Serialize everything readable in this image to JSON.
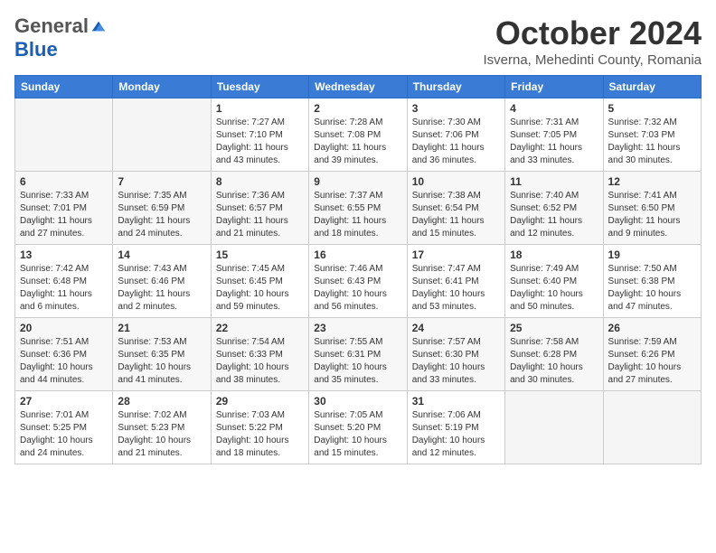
{
  "header": {
    "logo_general": "General",
    "logo_blue": "Blue",
    "month": "October 2024",
    "location": "Isverna, Mehedinti County, Romania"
  },
  "weekdays": [
    "Sunday",
    "Monday",
    "Tuesday",
    "Wednesday",
    "Thursday",
    "Friday",
    "Saturday"
  ],
  "weeks": [
    [
      {
        "day": "",
        "info": ""
      },
      {
        "day": "",
        "info": ""
      },
      {
        "day": "1",
        "info": "Sunrise: 7:27 AM\nSunset: 7:10 PM\nDaylight: 11 hours and 43 minutes."
      },
      {
        "day": "2",
        "info": "Sunrise: 7:28 AM\nSunset: 7:08 PM\nDaylight: 11 hours and 39 minutes."
      },
      {
        "day": "3",
        "info": "Sunrise: 7:30 AM\nSunset: 7:06 PM\nDaylight: 11 hours and 36 minutes."
      },
      {
        "day": "4",
        "info": "Sunrise: 7:31 AM\nSunset: 7:05 PM\nDaylight: 11 hours and 33 minutes."
      },
      {
        "day": "5",
        "info": "Sunrise: 7:32 AM\nSunset: 7:03 PM\nDaylight: 11 hours and 30 minutes."
      }
    ],
    [
      {
        "day": "6",
        "info": "Sunrise: 7:33 AM\nSunset: 7:01 PM\nDaylight: 11 hours and 27 minutes."
      },
      {
        "day": "7",
        "info": "Sunrise: 7:35 AM\nSunset: 6:59 PM\nDaylight: 11 hours and 24 minutes."
      },
      {
        "day": "8",
        "info": "Sunrise: 7:36 AM\nSunset: 6:57 PM\nDaylight: 11 hours and 21 minutes."
      },
      {
        "day": "9",
        "info": "Sunrise: 7:37 AM\nSunset: 6:55 PM\nDaylight: 11 hours and 18 minutes."
      },
      {
        "day": "10",
        "info": "Sunrise: 7:38 AM\nSunset: 6:54 PM\nDaylight: 11 hours and 15 minutes."
      },
      {
        "day": "11",
        "info": "Sunrise: 7:40 AM\nSunset: 6:52 PM\nDaylight: 11 hours and 12 minutes."
      },
      {
        "day": "12",
        "info": "Sunrise: 7:41 AM\nSunset: 6:50 PM\nDaylight: 11 hours and 9 minutes."
      }
    ],
    [
      {
        "day": "13",
        "info": "Sunrise: 7:42 AM\nSunset: 6:48 PM\nDaylight: 11 hours and 6 minutes."
      },
      {
        "day": "14",
        "info": "Sunrise: 7:43 AM\nSunset: 6:46 PM\nDaylight: 11 hours and 2 minutes."
      },
      {
        "day": "15",
        "info": "Sunrise: 7:45 AM\nSunset: 6:45 PM\nDaylight: 10 hours and 59 minutes."
      },
      {
        "day": "16",
        "info": "Sunrise: 7:46 AM\nSunset: 6:43 PM\nDaylight: 10 hours and 56 minutes."
      },
      {
        "day": "17",
        "info": "Sunrise: 7:47 AM\nSunset: 6:41 PM\nDaylight: 10 hours and 53 minutes."
      },
      {
        "day": "18",
        "info": "Sunrise: 7:49 AM\nSunset: 6:40 PM\nDaylight: 10 hours and 50 minutes."
      },
      {
        "day": "19",
        "info": "Sunrise: 7:50 AM\nSunset: 6:38 PM\nDaylight: 10 hours and 47 minutes."
      }
    ],
    [
      {
        "day": "20",
        "info": "Sunrise: 7:51 AM\nSunset: 6:36 PM\nDaylight: 10 hours and 44 minutes."
      },
      {
        "day": "21",
        "info": "Sunrise: 7:53 AM\nSunset: 6:35 PM\nDaylight: 10 hours and 41 minutes."
      },
      {
        "day": "22",
        "info": "Sunrise: 7:54 AM\nSunset: 6:33 PM\nDaylight: 10 hours and 38 minutes."
      },
      {
        "day": "23",
        "info": "Sunrise: 7:55 AM\nSunset: 6:31 PM\nDaylight: 10 hours and 35 minutes."
      },
      {
        "day": "24",
        "info": "Sunrise: 7:57 AM\nSunset: 6:30 PM\nDaylight: 10 hours and 33 minutes."
      },
      {
        "day": "25",
        "info": "Sunrise: 7:58 AM\nSunset: 6:28 PM\nDaylight: 10 hours and 30 minutes."
      },
      {
        "day": "26",
        "info": "Sunrise: 7:59 AM\nSunset: 6:26 PM\nDaylight: 10 hours and 27 minutes."
      }
    ],
    [
      {
        "day": "27",
        "info": "Sunrise: 7:01 AM\nSunset: 5:25 PM\nDaylight: 10 hours and 24 minutes."
      },
      {
        "day": "28",
        "info": "Sunrise: 7:02 AM\nSunset: 5:23 PM\nDaylight: 10 hours and 21 minutes."
      },
      {
        "day": "29",
        "info": "Sunrise: 7:03 AM\nSunset: 5:22 PM\nDaylight: 10 hours and 18 minutes."
      },
      {
        "day": "30",
        "info": "Sunrise: 7:05 AM\nSunset: 5:20 PM\nDaylight: 10 hours and 15 minutes."
      },
      {
        "day": "31",
        "info": "Sunrise: 7:06 AM\nSunset: 5:19 PM\nDaylight: 10 hours and 12 minutes."
      },
      {
        "day": "",
        "info": ""
      },
      {
        "day": "",
        "info": ""
      }
    ]
  ]
}
